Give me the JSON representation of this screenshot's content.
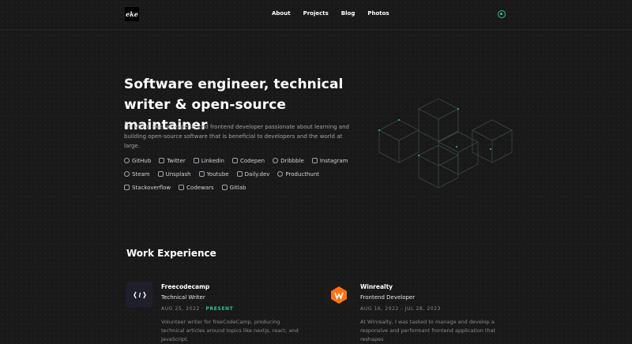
{
  "nav": {
    "logo_text": "eke",
    "links": [
      "About",
      "Projects",
      "Blog",
      "Photos"
    ]
  },
  "hero": {
    "title_line1": "Software engineer, technical",
    "title_line2": "writer & open-source maintainer",
    "description": "I'm Victor Eke, an experienced frontend developer passionate about learning and building open-source software that is beneficial to developers and the world at large."
  },
  "socials": {
    "row1": [
      "GitHub",
      "Twitter",
      "Linkedin",
      "Codepen",
      "Dribbble",
      "Instagram"
    ],
    "row2": [
      "Steam",
      "Unsplash",
      "Youtube",
      "Daily.dev",
      "Producthunt"
    ],
    "row3": [
      "Stackoverflow",
      "Codewars",
      "Gitlab"
    ]
  },
  "work": {
    "title": "Work Experience",
    "jobs": [
      {
        "company": "Freecodecamp",
        "role": "Technical Writer",
        "start": "AUG 25, 2022",
        "end": "PRESENT",
        "summary": "Volunteer writer for freeCodeCamp, producing technical articles around topics like nextjs, react, and JavaScript."
      },
      {
        "company": "Winrealty",
        "role": "Frontend Developer",
        "start": "AUG 16, 2022",
        "end": "JUL 28, 2023",
        "summary": "At Winrealty, I was tasked to manage and develop a responsive and performant frontend application that reshapes"
      }
    ]
  },
  "colors": {
    "accent": "#31c48d",
    "background": "#191919",
    "muted_text": "#a3a3a3",
    "winrealty_brand": "#f97316"
  }
}
